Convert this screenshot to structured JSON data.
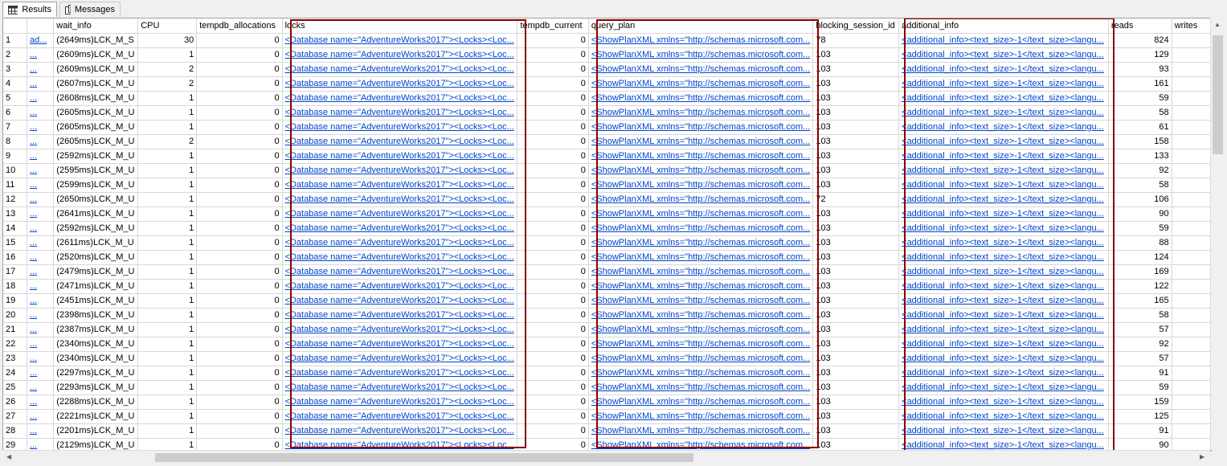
{
  "tabs": [
    {
      "label": "Results",
      "icon": "grid-icon"
    },
    {
      "label": "Messages",
      "icon": "messages-icon"
    }
  ],
  "columns": [
    "",
    "",
    "wait_info",
    "CPU",
    "tempdb_allocations",
    "locks",
    "tempdb_current",
    "query_plan",
    "blocking_session_id",
    "additional_info",
    "reads",
    "writes"
  ],
  "link_text": {
    "locks": "<Database name=\"AdventureWorks2017\"><Locks><Loc...",
    "query_plan": "<ShowPlanXML xmlns=\"http://schemas.microsoft.com...",
    "additional_info": "<additional_info><text_size>-1</text_size><langu..."
  },
  "rows": [
    {
      "n": "1",
      "sql": "ad...",
      "wait": "(2649ms)LCK_M_S",
      "cpu": "30",
      "alloc": "0",
      "cur": "0",
      "blk": "78",
      "reads": "824"
    },
    {
      "n": "2",
      "sql": "...",
      "wait": "(2609ms)LCK_M_U",
      "cpu": "1",
      "alloc": "0",
      "cur": "0",
      "blk": "103",
      "reads": "129"
    },
    {
      "n": "3",
      "sql": "...",
      "wait": "(2609ms)LCK_M_U",
      "cpu": "2",
      "alloc": "0",
      "cur": "0",
      "blk": "103",
      "reads": "93"
    },
    {
      "n": "4",
      "sql": "...",
      "wait": "(2607ms)LCK_M_U",
      "cpu": "2",
      "alloc": "0",
      "cur": "0",
      "blk": "103",
      "reads": "161"
    },
    {
      "n": "5",
      "sql": "...",
      "wait": "(2608ms)LCK_M_U",
      "cpu": "1",
      "alloc": "0",
      "cur": "0",
      "blk": "103",
      "reads": "59"
    },
    {
      "n": "6",
      "sql": "...",
      "wait": "(2605ms)LCK_M_U",
      "cpu": "1",
      "alloc": "0",
      "cur": "0",
      "blk": "103",
      "reads": "58"
    },
    {
      "n": "7",
      "sql": "...",
      "wait": "(2605ms)LCK_M_U",
      "cpu": "1",
      "alloc": "0",
      "cur": "0",
      "blk": "103",
      "reads": "61"
    },
    {
      "n": "8",
      "sql": "...",
      "wait": "(2605ms)LCK_M_U",
      "cpu": "2",
      "alloc": "0",
      "cur": "0",
      "blk": "103",
      "reads": "158"
    },
    {
      "n": "9",
      "sql": "...",
      "wait": "(2592ms)LCK_M_U",
      "cpu": "1",
      "alloc": "0",
      "cur": "0",
      "blk": "103",
      "reads": "133"
    },
    {
      "n": "10",
      "sql": "...",
      "wait": "(2595ms)LCK_M_U",
      "cpu": "1",
      "alloc": "0",
      "cur": "0",
      "blk": "103",
      "reads": "92"
    },
    {
      "n": "11",
      "sql": "...",
      "wait": "(2599ms)LCK_M_U",
      "cpu": "1",
      "alloc": "0",
      "cur": "0",
      "blk": "103",
      "reads": "58"
    },
    {
      "n": "12",
      "sql": "...",
      "wait": "(2650ms)LCK_M_U",
      "cpu": "1",
      "alloc": "0",
      "cur": "0",
      "blk": "72",
      "reads": "106"
    },
    {
      "n": "13",
      "sql": "...",
      "wait": "(2641ms)LCK_M_U",
      "cpu": "1",
      "alloc": "0",
      "cur": "0",
      "blk": "103",
      "reads": "90"
    },
    {
      "n": "14",
      "sql": "...",
      "wait": "(2592ms)LCK_M_U",
      "cpu": "1",
      "alloc": "0",
      "cur": "0",
      "blk": "103",
      "reads": "59"
    },
    {
      "n": "15",
      "sql": "...",
      "wait": "(2611ms)LCK_M_U",
      "cpu": "1",
      "alloc": "0",
      "cur": "0",
      "blk": "103",
      "reads": "88"
    },
    {
      "n": "16",
      "sql": "...",
      "wait": "(2520ms)LCK_M_U",
      "cpu": "1",
      "alloc": "0",
      "cur": "0",
      "blk": "103",
      "reads": "124"
    },
    {
      "n": "17",
      "sql": "...",
      "wait": "(2479ms)LCK_M_U",
      "cpu": "1",
      "alloc": "0",
      "cur": "0",
      "blk": "103",
      "reads": "169"
    },
    {
      "n": "18",
      "sql": "...",
      "wait": "(2471ms)LCK_M_U",
      "cpu": "1",
      "alloc": "0",
      "cur": "0",
      "blk": "103",
      "reads": "122"
    },
    {
      "n": "19",
      "sql": "...",
      "wait": "(2451ms)LCK_M_U",
      "cpu": "1",
      "alloc": "0",
      "cur": "0",
      "blk": "103",
      "reads": "165"
    },
    {
      "n": "20",
      "sql": "...",
      "wait": "(2398ms)LCK_M_U",
      "cpu": "1",
      "alloc": "0",
      "cur": "0",
      "blk": "103",
      "reads": "58"
    },
    {
      "n": "21",
      "sql": "...",
      "wait": "(2387ms)LCK_M_U",
      "cpu": "1",
      "alloc": "0",
      "cur": "0",
      "blk": "103",
      "reads": "57"
    },
    {
      "n": "22",
      "sql": "...",
      "wait": "(2340ms)LCK_M_U",
      "cpu": "1",
      "alloc": "0",
      "cur": "0",
      "blk": "103",
      "reads": "92"
    },
    {
      "n": "23",
      "sql": "...",
      "wait": "(2340ms)LCK_M_U",
      "cpu": "1",
      "alloc": "0",
      "cur": "0",
      "blk": "103",
      "reads": "57"
    },
    {
      "n": "24",
      "sql": "...",
      "wait": "(2297ms)LCK_M_U",
      "cpu": "1",
      "alloc": "0",
      "cur": "0",
      "blk": "103",
      "reads": "91"
    },
    {
      "n": "25",
      "sql": "...",
      "wait": "(2293ms)LCK_M_U",
      "cpu": "1",
      "alloc": "0",
      "cur": "0",
      "blk": "103",
      "reads": "59"
    },
    {
      "n": "26",
      "sql": "...",
      "wait": "(2288ms)LCK_M_U",
      "cpu": "1",
      "alloc": "0",
      "cur": "0",
      "blk": "103",
      "reads": "159"
    },
    {
      "n": "27",
      "sql": "...",
      "wait": "(2221ms)LCK_M_U",
      "cpu": "1",
      "alloc": "0",
      "cur": "0",
      "blk": "103",
      "reads": "125"
    },
    {
      "n": "28",
      "sql": "...",
      "wait": "(2201ms)LCK_M_U",
      "cpu": "1",
      "alloc": "0",
      "cur": "0",
      "blk": "103",
      "reads": "91"
    },
    {
      "n": "29",
      "sql": "...",
      "wait": "(2129ms)LCK_M_U",
      "cpu": "1",
      "alloc": "0",
      "cur": "0",
      "blk": "103",
      "reads": "90"
    }
  ],
  "colors": {
    "highlight_border": "#8b0000",
    "link": "#0044cc"
  }
}
